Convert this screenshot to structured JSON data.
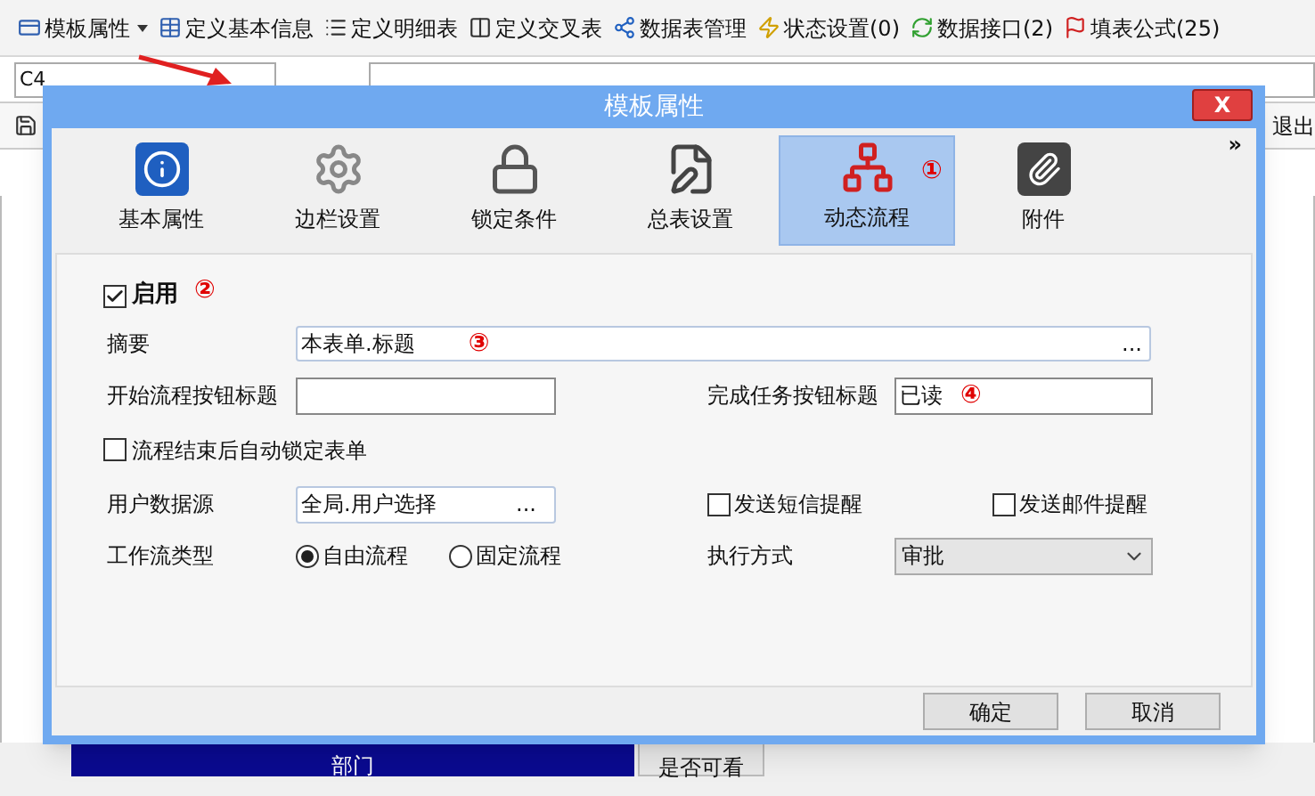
{
  "toolbar": {
    "items": [
      {
        "label": "模板属性",
        "dropdown": true
      },
      {
        "label": "定义基本信息",
        "dropdown": false
      },
      {
        "label": "定义明细表",
        "dropdown": false
      },
      {
        "label": "定义交叉表",
        "dropdown": false
      },
      {
        "label": "数据表管理",
        "dropdown": false
      },
      {
        "label": "状态设置(0)",
        "dropdown": false
      },
      {
        "label": "数据接口(2)",
        "dropdown": false
      },
      {
        "label": "填表公式(25)",
        "dropdown": false
      }
    ]
  },
  "formula_bar": {
    "cell_ref": "C4"
  },
  "side_toolbar": {
    "exit": "退出"
  },
  "sheet": {
    "columns": [
      "部门",
      "是否可看"
    ]
  },
  "dialog": {
    "title": "模板属性",
    "close": "X",
    "more": "»",
    "tabs": [
      {
        "label": "基本属性",
        "selected": false,
        "kind": "info"
      },
      {
        "label": "边栏设置",
        "selected": false,
        "kind": "gear"
      },
      {
        "label": "锁定条件",
        "selected": false,
        "kind": "lock"
      },
      {
        "label": "总表设置",
        "selected": false,
        "kind": "edit"
      },
      {
        "label": "动态流程",
        "selected": true,
        "kind": "flow",
        "annotation": "①"
      },
      {
        "label": "附件",
        "selected": false,
        "kind": "clip"
      }
    ],
    "enable": {
      "label": "启用",
      "checked": true,
      "annotation": "②"
    },
    "summary": {
      "label": "摘要",
      "value": "本表单.标题",
      "button": "...",
      "annotation": "③"
    },
    "start_button_title": {
      "label": "开始流程按钮标题"
    },
    "finish_button_title": {
      "label": "完成任务按钮标题",
      "value": "已读",
      "annotation": "④"
    },
    "auto_lock": {
      "label": "流程结束后自动锁定表单",
      "checked": false
    },
    "user_source": {
      "label": "用户数据源",
      "value": "全局.用户选择",
      "button": "..."
    },
    "sms_reminder": {
      "label": "发送短信提醒",
      "checked": false
    },
    "mail_reminder": {
      "label": "发送邮件提醒",
      "checked": false
    },
    "workflow_type": {
      "label": "工作流类型",
      "options": [
        {
          "label": "自由流程",
          "selected": true
        },
        {
          "label": "固定流程",
          "selected": false
        }
      ]
    },
    "execution_mode": {
      "label": "执行方式",
      "value": "审批"
    },
    "buttons": [
      "确定",
      "取消"
    ]
  }
}
